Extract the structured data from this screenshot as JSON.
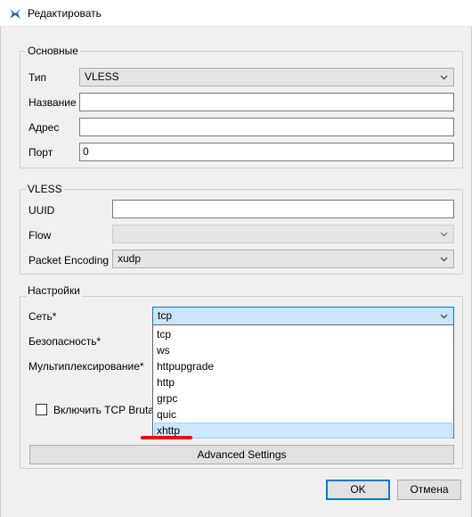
{
  "window": {
    "title": "Редактировать",
    "icon": "app-logo-icon"
  },
  "basic": {
    "title": "Основные",
    "type_label": "Тип",
    "type_value": "VLESS",
    "name_label": "Название",
    "name_value": "",
    "address_label": "Адрес",
    "address_value": "",
    "port_label": "Порт",
    "port_value": "0"
  },
  "vless": {
    "title": "VLESS",
    "uuid_label": "UUID",
    "uuid_value": "",
    "flow_label": "Flow",
    "flow_value": "",
    "packet_encoding_label": "Packet Encoding",
    "packet_encoding_value": "xudp"
  },
  "settings": {
    "title": "Настройки",
    "network_label": "Сеть*",
    "network_value": "tcp",
    "security_label": "Безопасность*",
    "mux_label": "Мультиплексирование*",
    "tcp_brutal_label": "Включить TCP Brutal",
    "network_options": [
      "tcp",
      "ws",
      "httpupgrade",
      "http",
      "grpc",
      "quic",
      "xhttp"
    ],
    "highlighted_option": "xhttp",
    "advanced_label": "Advanced Settings"
  },
  "footer": {
    "ok_label": "OK",
    "cancel_label": "Отмена"
  },
  "colors": {
    "accent": "#0078d7",
    "highlight_mark": "#ff0000",
    "selection": "#cce8ff"
  }
}
